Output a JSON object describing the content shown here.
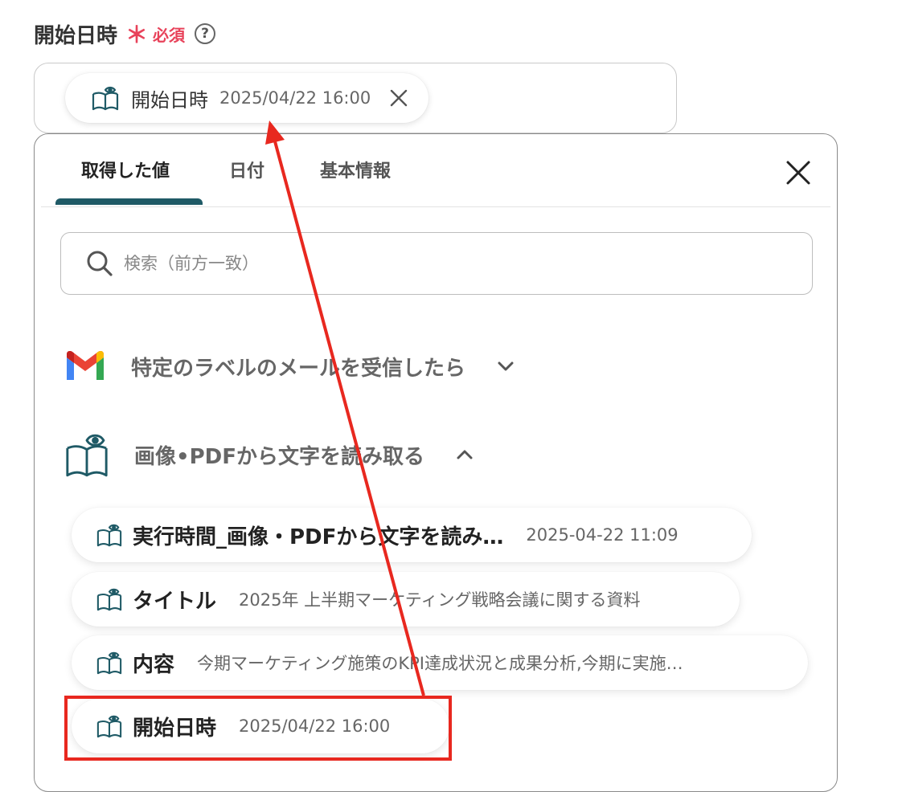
{
  "field": {
    "label": "開始日時",
    "asterisk": "＊",
    "required": "必須",
    "help": "?"
  },
  "selected_chip": {
    "name": "開始日時",
    "value": "2025/04/22 16:00"
  },
  "tabs": [
    {
      "label": "取得した値",
      "active": true
    },
    {
      "label": "日付",
      "active": false
    },
    {
      "label": "基本情報",
      "active": false
    }
  ],
  "search": {
    "placeholder": "検索（前方一致）"
  },
  "sections": [
    {
      "label": "特定のラベルのメールを受信したら",
      "icon": "gmail-icon",
      "expanded": false
    },
    {
      "label": "画像•PDFから文字を読み取る",
      "icon": "ocr-book-icon",
      "expanded": true
    }
  ],
  "items": [
    {
      "name": "実行時間_画像・PDFから文字を読み…",
      "value": "2025-04-22 11:09"
    },
    {
      "name": "タイトル",
      "value": "2025年 上半期マーケティング戦略会議に関する資料"
    },
    {
      "name": "内容",
      "value": "今期マーケティング施策のKPI達成状況と成果分析,今期に実施…"
    },
    {
      "name": "開始日時",
      "value": "2025/04/22 16:00"
    }
  ],
  "colors": {
    "accent": "#1f5a66",
    "required": "#e8425a",
    "annotation": "#e8281f"
  }
}
